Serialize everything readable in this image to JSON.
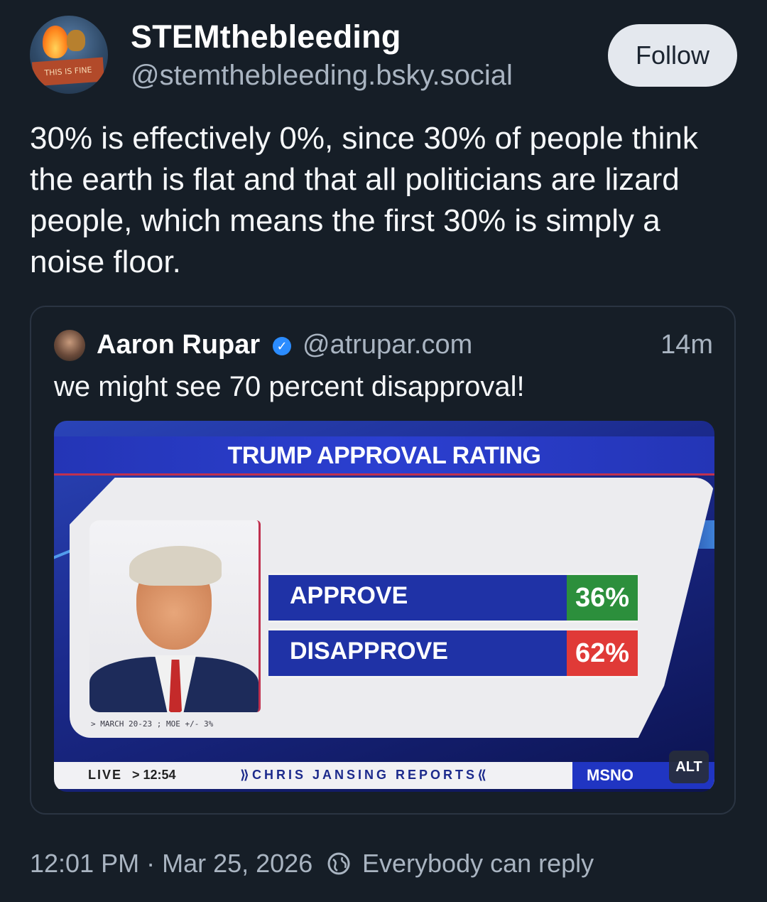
{
  "post": {
    "author_name": "STEMthebleeding",
    "author_handle": "@stemthebleeding.bsky.social",
    "avatar_sign_text": "THIS IS FINE",
    "follow_label": "Follow",
    "text": "30% is effectively 0%, since 30% of people think the earth is flat and that all politicians are lizard people, which means the first 30% is simply a noise floor.",
    "timestamp": "12:01 PM · Mar 25, 2026",
    "reply_setting": "Everybody can reply"
  },
  "quote": {
    "author_name": "Aaron Rupar",
    "verified_mark": "✓",
    "author_handle": "@atrupar.com",
    "time": "14m",
    "text": "we might see 70 percent disapproval!",
    "media": {
      "banner_title": "TRUMP APPROVAL RATING",
      "approve_label": "APPROVE",
      "approve_value": "36%",
      "disapprove_label": "DISAPPROVE",
      "disapprove_value": "62%",
      "moe_text": "> MARCH 20-23 ; MOE +/- 3%",
      "live_label": "LIVE",
      "clock": "> 12:54",
      "show_name": "⟫CHRIS JANSING REPORTS⟪",
      "network": "MSNO",
      "alt_label": "ALT"
    }
  },
  "colors": {
    "background": "#161e27",
    "approve": "#2c8f3c",
    "disapprove": "#e03a37",
    "accent_blue": "#2435b6"
  }
}
